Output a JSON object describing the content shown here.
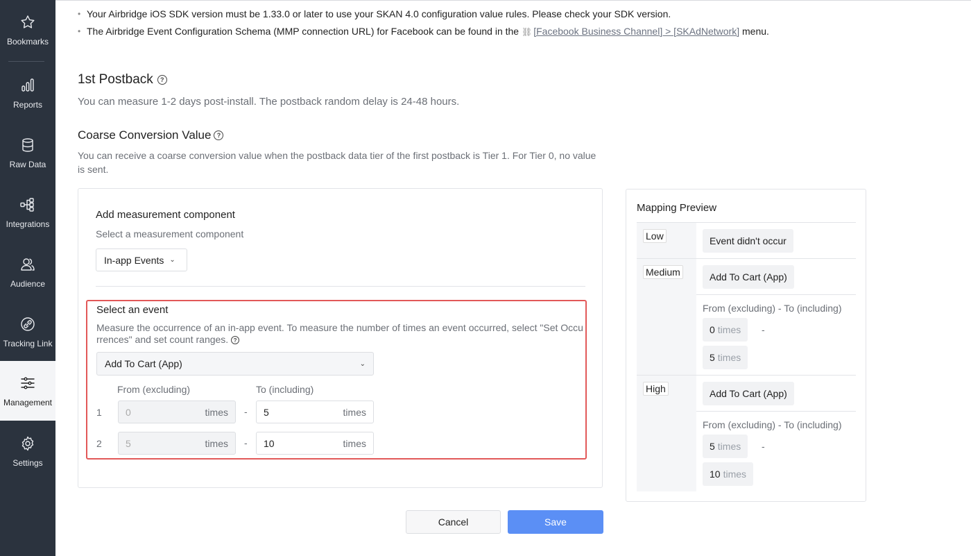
{
  "sidebar": {
    "items": [
      {
        "label": "Bookmarks",
        "icon": "star-icon"
      },
      {
        "label": "Reports",
        "icon": "bar-chart-icon"
      },
      {
        "label": "Raw Data",
        "icon": "database-icon"
      },
      {
        "label": "Integrations",
        "icon": "integrations-icon"
      },
      {
        "label": "Audience",
        "icon": "audience-icon"
      },
      {
        "label": "Tracking Link",
        "icon": "link-icon"
      },
      {
        "label": "Management",
        "icon": "sliders-icon"
      },
      {
        "label": "Settings",
        "icon": "gear-icon"
      }
    ],
    "active": "Management"
  },
  "notes": {
    "n1": "Your Airbridge iOS SDK version must be 1.33.0 or later to use your SKAN 4.0 configuration value rules. Please check your SDK version.",
    "n2_before": "The Airbridge Event Configuration Schema (MMP connection URL) for Facebook can be found in the",
    "n2_link": "[Facebook Business Channel] > [SKAdNetwork]",
    "n2_after": "menu."
  },
  "postback": {
    "title": "1st Postback",
    "desc": "You can measure 1-2 days post-install. The postback random delay is 24-48 hours."
  },
  "coarse": {
    "title": "Coarse Conversion Value",
    "desc": "You can receive a coarse conversion value when the postback data tier of the first postback is Tier 1. For Tier 0, no value is sent."
  },
  "measurement": {
    "title": "Add measurement component",
    "subtitle": "Select a measurement component",
    "selected": "In-app Events"
  },
  "event": {
    "title": "Select an event",
    "desc": "Measure the occurrence of an in-app event. To measure the number of times an event occurred, select \"Set Occurrences\" and set count ranges.",
    "selected": "Add To Cart (App)",
    "from_header": "From (excluding)",
    "to_header": "To (including)",
    "unit": "times",
    "rows": [
      {
        "num": "1",
        "from": "0",
        "to": "5"
      },
      {
        "num": "2",
        "from": "5",
        "to": "10"
      }
    ]
  },
  "preview": {
    "title": "Mapping Preview",
    "range_label": "From (excluding) - To (including)",
    "unit": "times",
    "low": {
      "level": "Low",
      "event": "Event didn't occur"
    },
    "medium": {
      "level": "Medium",
      "event": "Add To Cart (App)",
      "from": "0",
      "to": "5"
    },
    "high": {
      "level": "High",
      "event": "Add To Cart (App)",
      "from": "5",
      "to": "10"
    }
  },
  "buttons": {
    "cancel": "Cancel",
    "save": "Save"
  }
}
